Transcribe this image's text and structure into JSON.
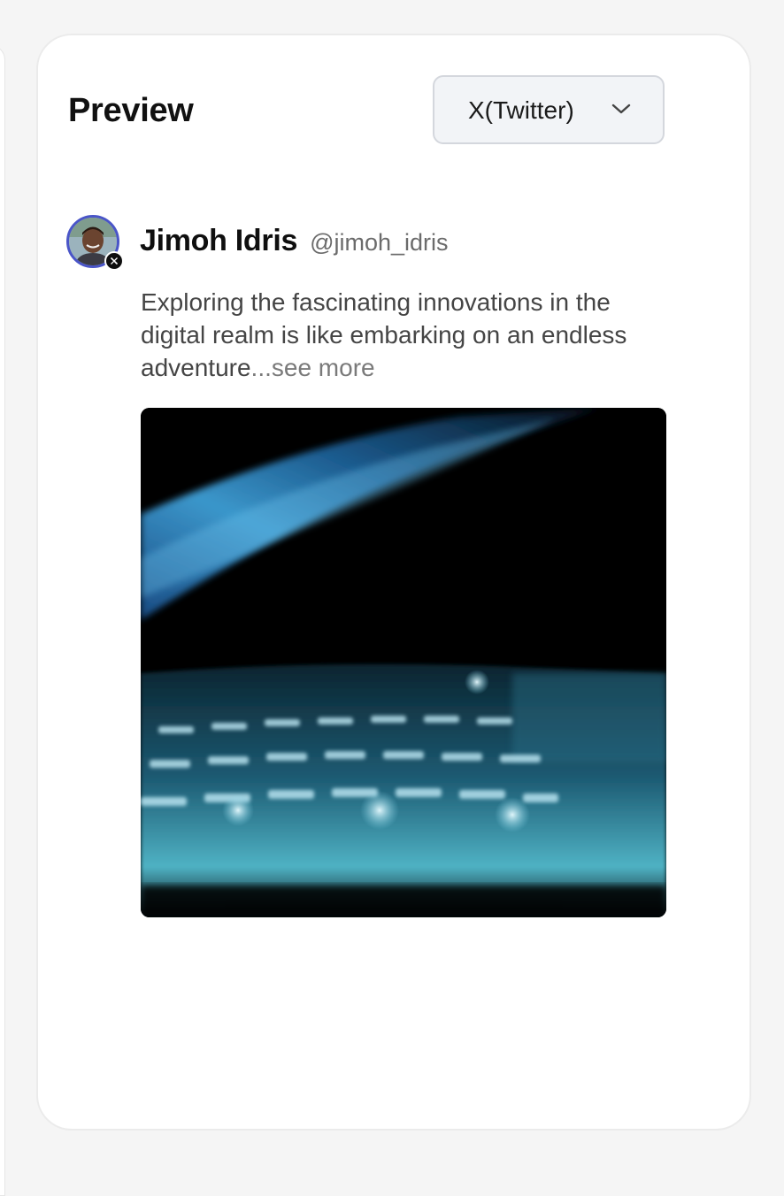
{
  "panel": {
    "title": "Preview"
  },
  "platform_select": {
    "selected": "X(Twitter)",
    "icon": "chevron-down-icon"
  },
  "post": {
    "author_name": "Jimoh Idris",
    "author_handle": "@jimoh_idris",
    "text": "Exploring the fascinating innovations in the digital realm is like embarking on an endless adventure",
    "see_more": "...see more",
    "avatar_badge_icon": "x-logo-icon",
    "image_icon": "laptop-keyboard-photo"
  },
  "colors": {
    "avatar_ring": "#4a55c8",
    "select_background": "#f2f4f7",
    "select_border": "#d4d7dd",
    "card_background": "#ffffff",
    "page_background": "#f5f5f5"
  }
}
